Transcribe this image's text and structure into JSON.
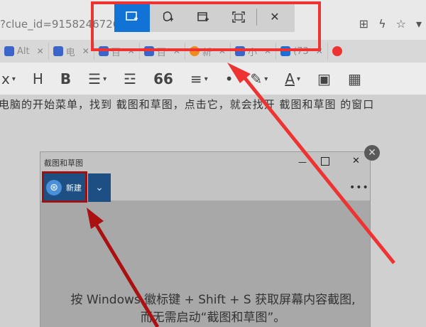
{
  "browser": {
    "url_text": "?clue_id=91582467262",
    "tabs": [
      {
        "label": "Alt",
        "icon": "paw-icon",
        "color": "#3b65c8"
      },
      {
        "label": "电",
        "icon": "paw-icon",
        "color": "#3b65c8"
      },
      {
        "label": "百",
        "icon": "paw-icon",
        "color": "#3b65c8"
      },
      {
        "label": "百",
        "icon": "paw-icon",
        "color": "#3b65c8"
      },
      {
        "label": "新",
        "icon": "orange-circle-icon",
        "color": "#f08c1e"
      },
      {
        "label": "小",
        "icon": "calendar-icon",
        "color": "#3b65c8"
      },
      {
        "label": "(73",
        "icon": "zhi-icon",
        "color": "#1d6fd6"
      },
      {
        "label": "",
        "icon": "red-swirl-icon",
        "color": "#e33"
      }
    ]
  },
  "editor_toolbar": {
    "items": [
      "x",
      "H",
      "B",
      "☰",
      "☲",
      "66",
      "≡",
      "•",
      "✎",
      "A",
      "▣",
      "▦"
    ]
  },
  "content_text": "电脑的开始菜单，找到 截图和草图，点击它，就会找开 截图和草图 的窗口",
  "snip_window": {
    "title": "截图和草图",
    "new_label": "新建",
    "hint_line1": "按 Windows 徽标键 + Shift + S 获取屏幕内容截图,",
    "hint_line2": "而无需启动“截图和草图”。"
  },
  "snip_toolbar": {
    "buttons": [
      {
        "name": "rectangular-snip",
        "active": true
      },
      {
        "name": "freeform-snip",
        "active": false
      },
      {
        "name": "window-snip",
        "active": false
      },
      {
        "name": "fullscreen-snip",
        "active": false
      },
      {
        "name": "close",
        "active": false
      }
    ]
  },
  "colors": {
    "highlight": "#e33",
    "accent": "#1273d6",
    "button_dark": "#1d4f82"
  }
}
